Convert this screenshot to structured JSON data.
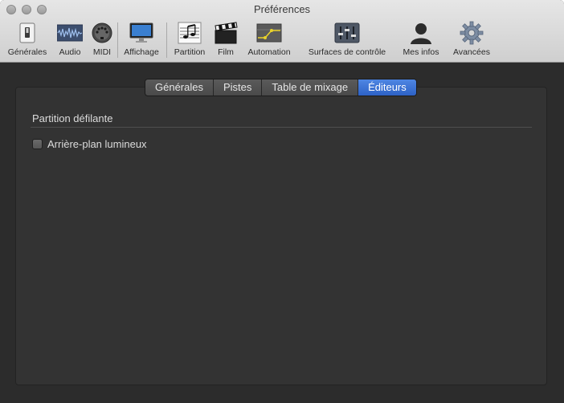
{
  "window": {
    "title": "Préférences"
  },
  "toolbar": {
    "items": [
      {
        "label": "Générales",
        "icon": "switch-icon"
      },
      {
        "label": "Audio",
        "icon": "waveform-icon"
      },
      {
        "label": "MIDI",
        "icon": "midi-connector-icon"
      },
      {
        "label": "Affichage",
        "icon": "monitor-icon"
      },
      {
        "label": "Partition",
        "icon": "sheet-music-icon"
      },
      {
        "label": "Film",
        "icon": "clapperboard-icon"
      },
      {
        "label": "Automation",
        "icon": "automation-curve-icon"
      },
      {
        "label": "Surfaces de contrôle",
        "icon": "faders-icon"
      },
      {
        "label": "Mes infos",
        "icon": "person-icon"
      },
      {
        "label": "Avancées",
        "icon": "gear-icon"
      }
    ]
  },
  "tabs": [
    {
      "label": "Générales",
      "active": false
    },
    {
      "label": "Pistes",
      "active": false
    },
    {
      "label": "Table de mixage",
      "active": false
    },
    {
      "label": "Éditeurs",
      "active": true
    }
  ],
  "content": {
    "section_title": "Partition défilante",
    "checkbox_label": "Arrière-plan lumineux",
    "checkbox_checked": false
  },
  "colors": {
    "accent": "#2d62c6",
    "window_bg": "#2c2c2c",
    "toolbar_bg": "#d8d8d8"
  }
}
